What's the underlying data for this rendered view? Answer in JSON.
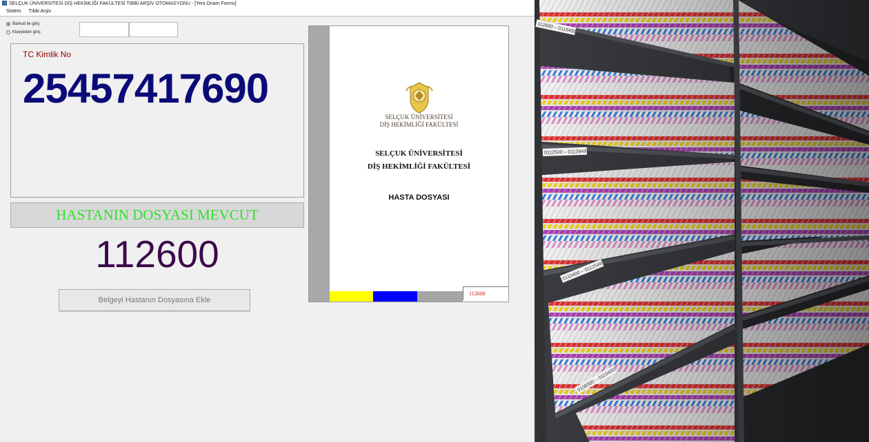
{
  "window": {
    "title": "SELÇUK ÜNİVERSİTESİ DİŞ HEKİMLİĞİ FAKÜLTESİ TIBBİ ARŞİV OTOMASYONU - [Yeni Onam Formu]"
  },
  "menu": {
    "items": [
      "Sistem",
      "Tıbbi Arşiv"
    ]
  },
  "input_mode": {
    "options": [
      "Barkod ile giriş",
      "Klavyeden giriş"
    ],
    "selected": "Barkod ile giriş"
  },
  "tc": {
    "label": "TC Kimlik No",
    "value": "25457417690"
  },
  "status": {
    "text": "HASTANIN DOSYASI MEVCUT",
    "color": "#2ee02e"
  },
  "file_number": "112600",
  "add_button": {
    "label": "Belgeyi Hastanın Dosyasına Ekle"
  },
  "preview": {
    "logo_line1": "SELÇUK ÜNİVERSİTESİ",
    "logo_line2": "DİŞ HEKİMLİĞİ FAKÜLTESİ",
    "heading1": "SELÇUK ÜNİVERSİTESİ",
    "heading2": "DİŞ HEKİMLİĞİ FAKÜLTESİ",
    "title": "HASTA DOSYASI",
    "tab_number": "112600",
    "stripe_colors": [
      "#ffff00",
      "#0000ff",
      "#a6a6a6"
    ]
  },
  "photo": {
    "shelf_labels": [
      "112600 – 0116455",
      "0112500 – 0112649",
      "0110400 – 0112549",
      "0108300 – 0110400"
    ]
  }
}
